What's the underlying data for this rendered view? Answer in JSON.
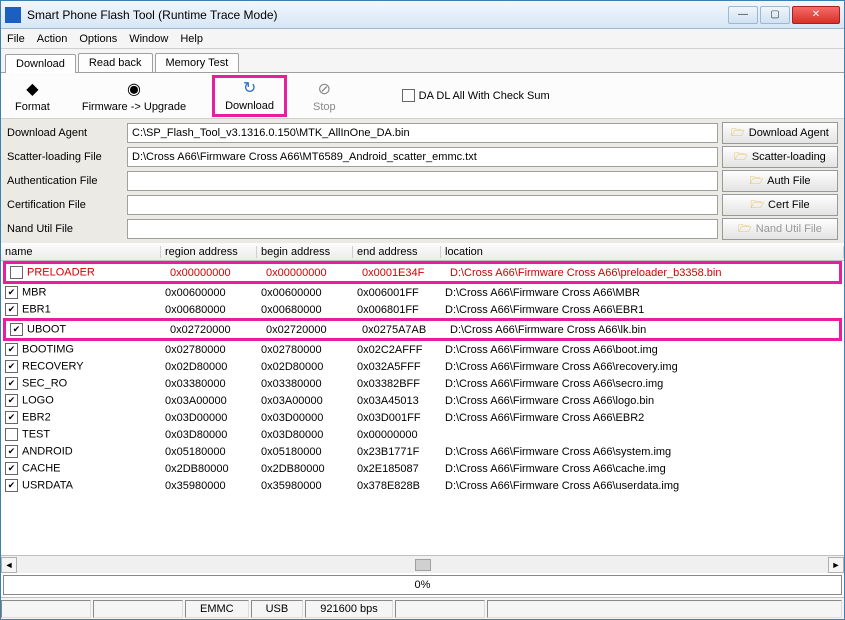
{
  "window": {
    "title": "Smart Phone Flash Tool (Runtime Trace Mode)"
  },
  "menu": [
    "File",
    "Action",
    "Options",
    "Window",
    "Help"
  ],
  "tabs": [
    {
      "label": "Download",
      "active": true
    },
    {
      "label": "Read back",
      "active": false
    },
    {
      "label": "Memory Test",
      "active": false
    }
  ],
  "toolbar": {
    "format": "Format",
    "firmware": "Firmware -> Upgrade",
    "download": "Download",
    "stop": "Stop",
    "checksum": "DA DL All With Check Sum"
  },
  "form": {
    "download_agent": {
      "label": "Download Agent",
      "value": "C:\\SP_Flash_Tool_v3.1316.0.150\\MTK_AllInOne_DA.bin",
      "button": "Download Agent"
    },
    "scatter": {
      "label": "Scatter-loading File",
      "value": "D:\\Cross A66\\Firmware Cross A66\\MT6589_Android_scatter_emmc.txt",
      "button": "Scatter-loading"
    },
    "auth": {
      "label": "Authentication File",
      "value": "",
      "button": "Auth File"
    },
    "cert": {
      "label": "Certification File",
      "value": "",
      "button": "Cert File"
    },
    "nand": {
      "label": "Nand Util File",
      "value": "",
      "button": "Nand Util File"
    }
  },
  "columns": [
    "name",
    "region address",
    "begin address",
    "end address",
    "location"
  ],
  "rows": [
    {
      "checked": false,
      "red": true,
      "hl": "pre",
      "name": "PRELOADER",
      "region": "0x00000000",
      "begin": "0x00000000",
      "end": "0x0001E34F",
      "loc": "D:\\Cross A66\\Firmware Cross A66\\preloader_b3358.bin"
    },
    {
      "checked": true,
      "name": "MBR",
      "region": "0x00600000",
      "begin": "0x00600000",
      "end": "0x006001FF",
      "loc": "D:\\Cross A66\\Firmware Cross A66\\MBR"
    },
    {
      "checked": true,
      "name": "EBR1",
      "region": "0x00680000",
      "begin": "0x00680000",
      "end": "0x006801FF",
      "loc": "D:\\Cross A66\\Firmware Cross A66\\EBR1"
    },
    {
      "checked": true,
      "hl": "uboot",
      "name": "UBOOT",
      "region": "0x02720000",
      "begin": "0x02720000",
      "end": "0x0275A7AB",
      "loc": "D:\\Cross A66\\Firmware Cross A66\\lk.bin"
    },
    {
      "checked": true,
      "name": "BOOTIMG",
      "region": "0x02780000",
      "begin": "0x02780000",
      "end": "0x02C2AFFF",
      "loc": "D:\\Cross A66\\Firmware Cross A66\\boot.img"
    },
    {
      "checked": true,
      "name": "RECOVERY",
      "region": "0x02D80000",
      "begin": "0x02D80000",
      "end": "0x032A5FFF",
      "loc": "D:\\Cross A66\\Firmware Cross A66\\recovery.img"
    },
    {
      "checked": true,
      "name": "SEC_RO",
      "region": "0x03380000",
      "begin": "0x03380000",
      "end": "0x03382BFF",
      "loc": "D:\\Cross A66\\Firmware Cross A66\\secro.img"
    },
    {
      "checked": true,
      "name": "LOGO",
      "region": "0x03A00000",
      "begin": "0x03A00000",
      "end": "0x03A45013",
      "loc": "D:\\Cross A66\\Firmware Cross A66\\logo.bin"
    },
    {
      "checked": true,
      "name": "EBR2",
      "region": "0x03D00000",
      "begin": "0x03D00000",
      "end": "0x03D001FF",
      "loc": "D:\\Cross A66\\Firmware Cross A66\\EBR2"
    },
    {
      "checked": false,
      "name": "TEST",
      "region": "0x03D80000",
      "begin": "0x03D80000",
      "end": "0x00000000",
      "loc": ""
    },
    {
      "checked": true,
      "name": "ANDROID",
      "region": "0x05180000",
      "begin": "0x05180000",
      "end": "0x23B1771F",
      "loc": "D:\\Cross A66\\Firmware Cross A66\\system.img"
    },
    {
      "checked": true,
      "name": "CACHE",
      "region": "0x2DB80000",
      "begin": "0x2DB80000",
      "end": "0x2E185087",
      "loc": "D:\\Cross A66\\Firmware Cross A66\\cache.img"
    },
    {
      "checked": true,
      "name": "USRDATA",
      "region": "0x35980000",
      "begin": "0x35980000",
      "end": "0x378E828B",
      "loc": "D:\\Cross A66\\Firmware Cross A66\\userdata.img"
    }
  ],
  "progress": "0%",
  "status": {
    "emmc": "EMMC",
    "usb": "USB",
    "baud": "921600 bps"
  }
}
